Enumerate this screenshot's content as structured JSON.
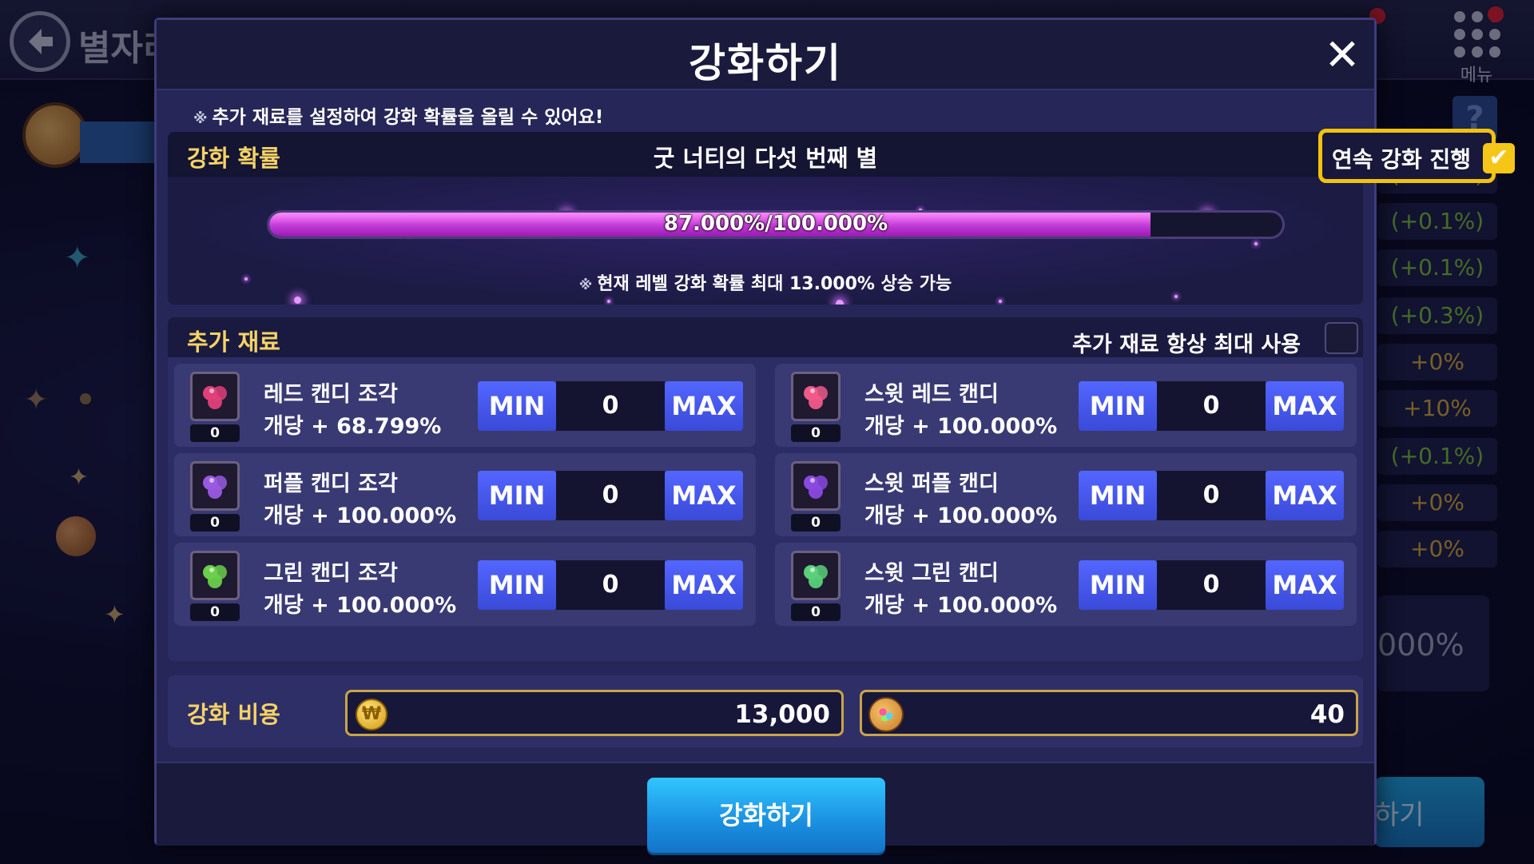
{
  "background": {
    "title_partial": "별자리",
    "menu_label": "메뉴",
    "help_label": "?",
    "side_stats": [
      "(+0.1%)",
      "(+0.1%)",
      "(+0.1%)",
      "(+0.3%)",
      "+0%",
      "+10%",
      "(+0.1%)",
      "+0%",
      "+0%"
    ],
    "side_big_value": "000%",
    "side_button_partial": "하기"
  },
  "modal": {
    "title": "강화하기",
    "close_icon": "close-icon",
    "notice_mark": "※",
    "notice": "추가 재료를 설정하여 강화 확률을 올릴 수 있어요!"
  },
  "probability": {
    "label": "강화 확률",
    "item_name": "굿 너티의 다섯 번째 별",
    "auto_label": "연속 강화 진행",
    "auto_checked": true,
    "current": 87.0,
    "max": 100.0,
    "bar_text": "87.000%/100.000%",
    "note_mark": "※",
    "note": "현재 레벨 강화 확률 최대 13.000% 상승 가능",
    "bar_color": "#c13ad6"
  },
  "materials": {
    "label": "추가 재료",
    "auto_max_label": "추가 재료 항상 최대 사용",
    "auto_max_checked": false,
    "min_label": "MIN",
    "max_label": "MAX",
    "items": [
      {
        "name": "레드 캔디 조각",
        "bonus": "개당 + 68.799%",
        "count": "0",
        "qty": "0",
        "icon": "red-candy-piece-icon",
        "color": "#e0407a"
      },
      {
        "name": "스윗 레드 캔디",
        "bonus": "개당 + 100.000%",
        "count": "0",
        "qty": "0",
        "icon": "sweet-red-candy-icon",
        "color": "#f05a8a"
      },
      {
        "name": "퍼플 캔디 조각",
        "bonus": "개당 + 100.000%",
        "count": "0",
        "qty": "0",
        "icon": "purple-candy-piece-icon",
        "color": "#9a5ae0"
      },
      {
        "name": "스윗 퍼플 캔디",
        "bonus": "개당 + 100.000%",
        "count": "0",
        "qty": "0",
        "icon": "sweet-purple-candy-icon",
        "color": "#8a4ae0"
      },
      {
        "name": "그린 캔디 조각",
        "bonus": "개당 + 100.000%",
        "count": "0",
        "qty": "0",
        "icon": "green-candy-piece-icon",
        "color": "#6ad04a"
      },
      {
        "name": "스윗 그린 캔디",
        "bonus": "개당 + 100.000%",
        "count": "0",
        "qty": "0",
        "icon": "sweet-green-candy-icon",
        "color": "#5ad07a"
      }
    ]
  },
  "cost": {
    "label": "강화 비용",
    "coin_value": "13,000",
    "jar_value": "40",
    "coin_icon": "coin-icon",
    "jar_icon": "candy-jar-icon"
  },
  "footer": {
    "confirm_label": "강화하기"
  }
}
